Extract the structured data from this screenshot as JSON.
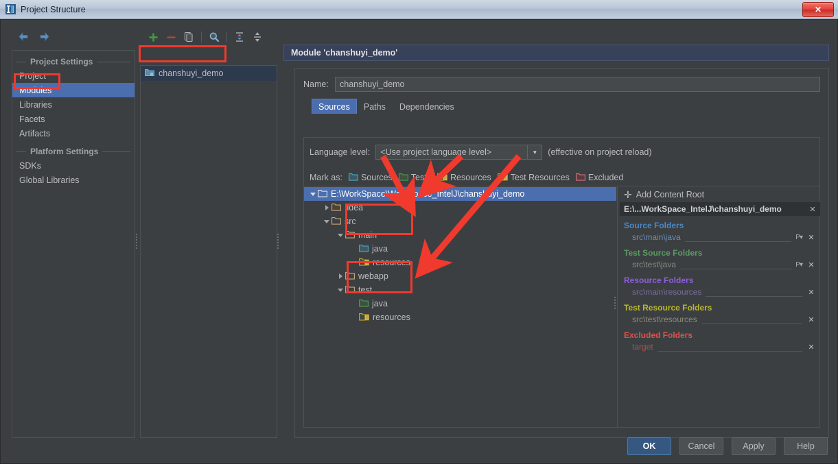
{
  "window": {
    "title": "Project Structure",
    "icon": "intellij-logo-icon",
    "close_label": "✕"
  },
  "toolbar": {
    "back_icon": "arrow-left-icon",
    "forward_icon": "arrow-right-icon",
    "add_icon": "plus-icon",
    "remove_icon": "minus-icon",
    "copy_icon": "copy-icon",
    "search_icon": "search-icon",
    "expand_icon": "expand-all-icon",
    "collapse_icon": "collapse-all-icon"
  },
  "sidebar": {
    "groups": [
      {
        "title": "Project Settings",
        "items": [
          {
            "label": "Project",
            "selected": false
          },
          {
            "label": "Modules",
            "selected": true
          },
          {
            "label": "Libraries",
            "selected": false
          },
          {
            "label": "Facets",
            "selected": false
          },
          {
            "label": "Artifacts",
            "selected": false
          }
        ]
      },
      {
        "title": "Platform Settings",
        "items": [
          {
            "label": "SDKs",
            "selected": false
          },
          {
            "label": "Global Libraries",
            "selected": false
          }
        ]
      }
    ]
  },
  "module_list": {
    "items": [
      {
        "label": "chanshuyi_demo",
        "icon": "module-folder-icon",
        "selected": true
      }
    ]
  },
  "main": {
    "header": "Module 'chanshuyi_demo'",
    "name_label": "Name:",
    "name_value": "chanshuyi_demo",
    "tabs": [
      {
        "label": "Sources",
        "active": true
      },
      {
        "label": "Paths",
        "active": false
      },
      {
        "label": "Dependencies",
        "active": false
      }
    ],
    "language_level": {
      "label": "Language level:",
      "value": "<Use project language level>",
      "note": "(effective on project reload)",
      "arrow_icon": "chevron-down-icon"
    },
    "mark_as": {
      "label": "Mark as:",
      "options": [
        {
          "label": "Sources",
          "accent": "#4ba8c4",
          "underline": "S"
        },
        {
          "label": "Tests",
          "accent": "#4f9a57",
          "underline": "T"
        },
        {
          "label": "Resources",
          "accent": "#c9a227",
          "underline": "R"
        },
        {
          "label": "Test Resources",
          "accent": "#c9a227",
          "underline": "T"
        },
        {
          "label": "Excluded",
          "accent": "#d9707a",
          "underline": "E"
        }
      ]
    },
    "tree": [
      {
        "label": "E:\\WorkSpace\\WorkSpace_IntelJ\\chanshuyi_demo",
        "depth": 0,
        "toggle": "down",
        "folder": "tan",
        "selected": true
      },
      {
        "label": ".idea",
        "depth": 1,
        "toggle": "right",
        "folder": "tan",
        "selected": false
      },
      {
        "label": "src",
        "depth": 1,
        "toggle": "down",
        "folder": "tan",
        "selected": false
      },
      {
        "label": "main",
        "depth": 2,
        "toggle": "down",
        "folder": "tan",
        "selected": false
      },
      {
        "label": "java",
        "depth": 3,
        "toggle": "none",
        "folder": "blue",
        "selected": false
      },
      {
        "label": "resources",
        "depth": 3,
        "toggle": "none",
        "folder": "res",
        "selected": false
      },
      {
        "label": "webapp",
        "depth": 2,
        "toggle": "right",
        "folder": "tan",
        "selected": false
      },
      {
        "label": "test",
        "depth": 2,
        "toggle": "down",
        "folder": "tan",
        "selected": false
      },
      {
        "label": "java",
        "depth": 3,
        "toggle": "none",
        "folder": "green",
        "selected": false
      },
      {
        "label": "resources",
        "depth": 3,
        "toggle": "none",
        "folder": "res",
        "selected": false
      }
    ],
    "roots": {
      "add_content_root": "Add Content Root",
      "root_path": "E:\\...WorkSpace_IntelJ\\chanshuyi_demo",
      "close_label": "✕",
      "groups": [
        {
          "title": "Source Folders",
          "color": "#4a88c7",
          "entries": [
            {
              "path": "src\\main\\java",
              "color": "#6b8cb3",
              "has_package_prefix": true
            }
          ]
        },
        {
          "title": "Test Source Folders",
          "color": "#5b9a63",
          "entries": [
            {
              "path": "src\\test\\java",
              "color": "#7f8f80",
              "has_package_prefix": true
            }
          ]
        },
        {
          "title": "Resource Folders",
          "color": "#8b5fd9",
          "entries": [
            {
              "path": "src\\main\\resources",
              "color": "#7a6a9e",
              "has_package_prefix": false
            }
          ]
        },
        {
          "title": "Test Resource Folders",
          "color": "#b8b830",
          "entries": [
            {
              "path": "src\\test\\resources",
              "color": "#8b8b74",
              "has_package_prefix": false
            }
          ]
        },
        {
          "title": "Excluded Folders",
          "color": "#d9534f",
          "entries": [
            {
              "path": "target",
              "color": "#a65450",
              "has_package_prefix": false
            }
          ]
        }
      ]
    }
  },
  "buttons": [
    {
      "label": "OK",
      "primary": true,
      "underline": ""
    },
    {
      "label": "Cancel",
      "primary": false,
      "underline": ""
    },
    {
      "label": "Apply",
      "primary": false,
      "underline": "A"
    },
    {
      "label": "Help",
      "primary": false,
      "underline": ""
    }
  ],
  "annotations": {
    "accent": "#f03a2e",
    "boxes": [
      "modules-sidebar-item",
      "module-list-item",
      "main-java-resources",
      "test-java-resources"
    ],
    "arrows": 3
  }
}
